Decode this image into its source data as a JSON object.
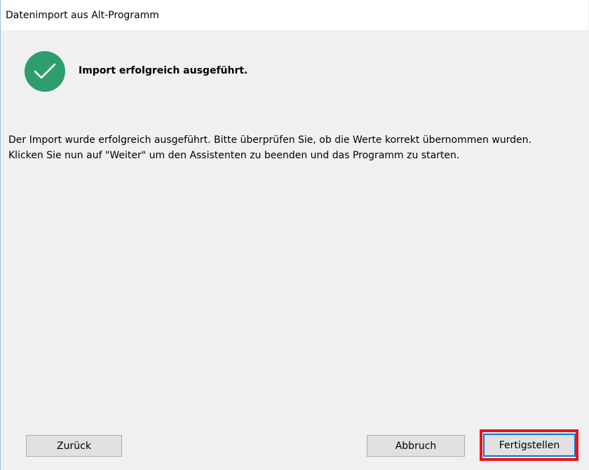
{
  "window": {
    "title": "Datenimport aus Alt-Programm"
  },
  "status": {
    "icon": "check-circle-icon",
    "color": "#2e9e6f",
    "headline": "Import erfolgreich ausgeführt."
  },
  "message": {
    "line1": "Der Import wurde erfolgreich ausgeführt. Bitte überprüfen Sie, ob die Werte korrekt übernommen wurden.",
    "line2": "Klicken Sie nun auf \"Weiter\" um den Assistenten zu beenden und das Programm zu starten."
  },
  "buttons": {
    "back_label": "Zurück",
    "cancel_label": "Abbruch",
    "finish_label": "Fertigstellen"
  },
  "annotation": {
    "highlight_color": "#e8121e"
  }
}
